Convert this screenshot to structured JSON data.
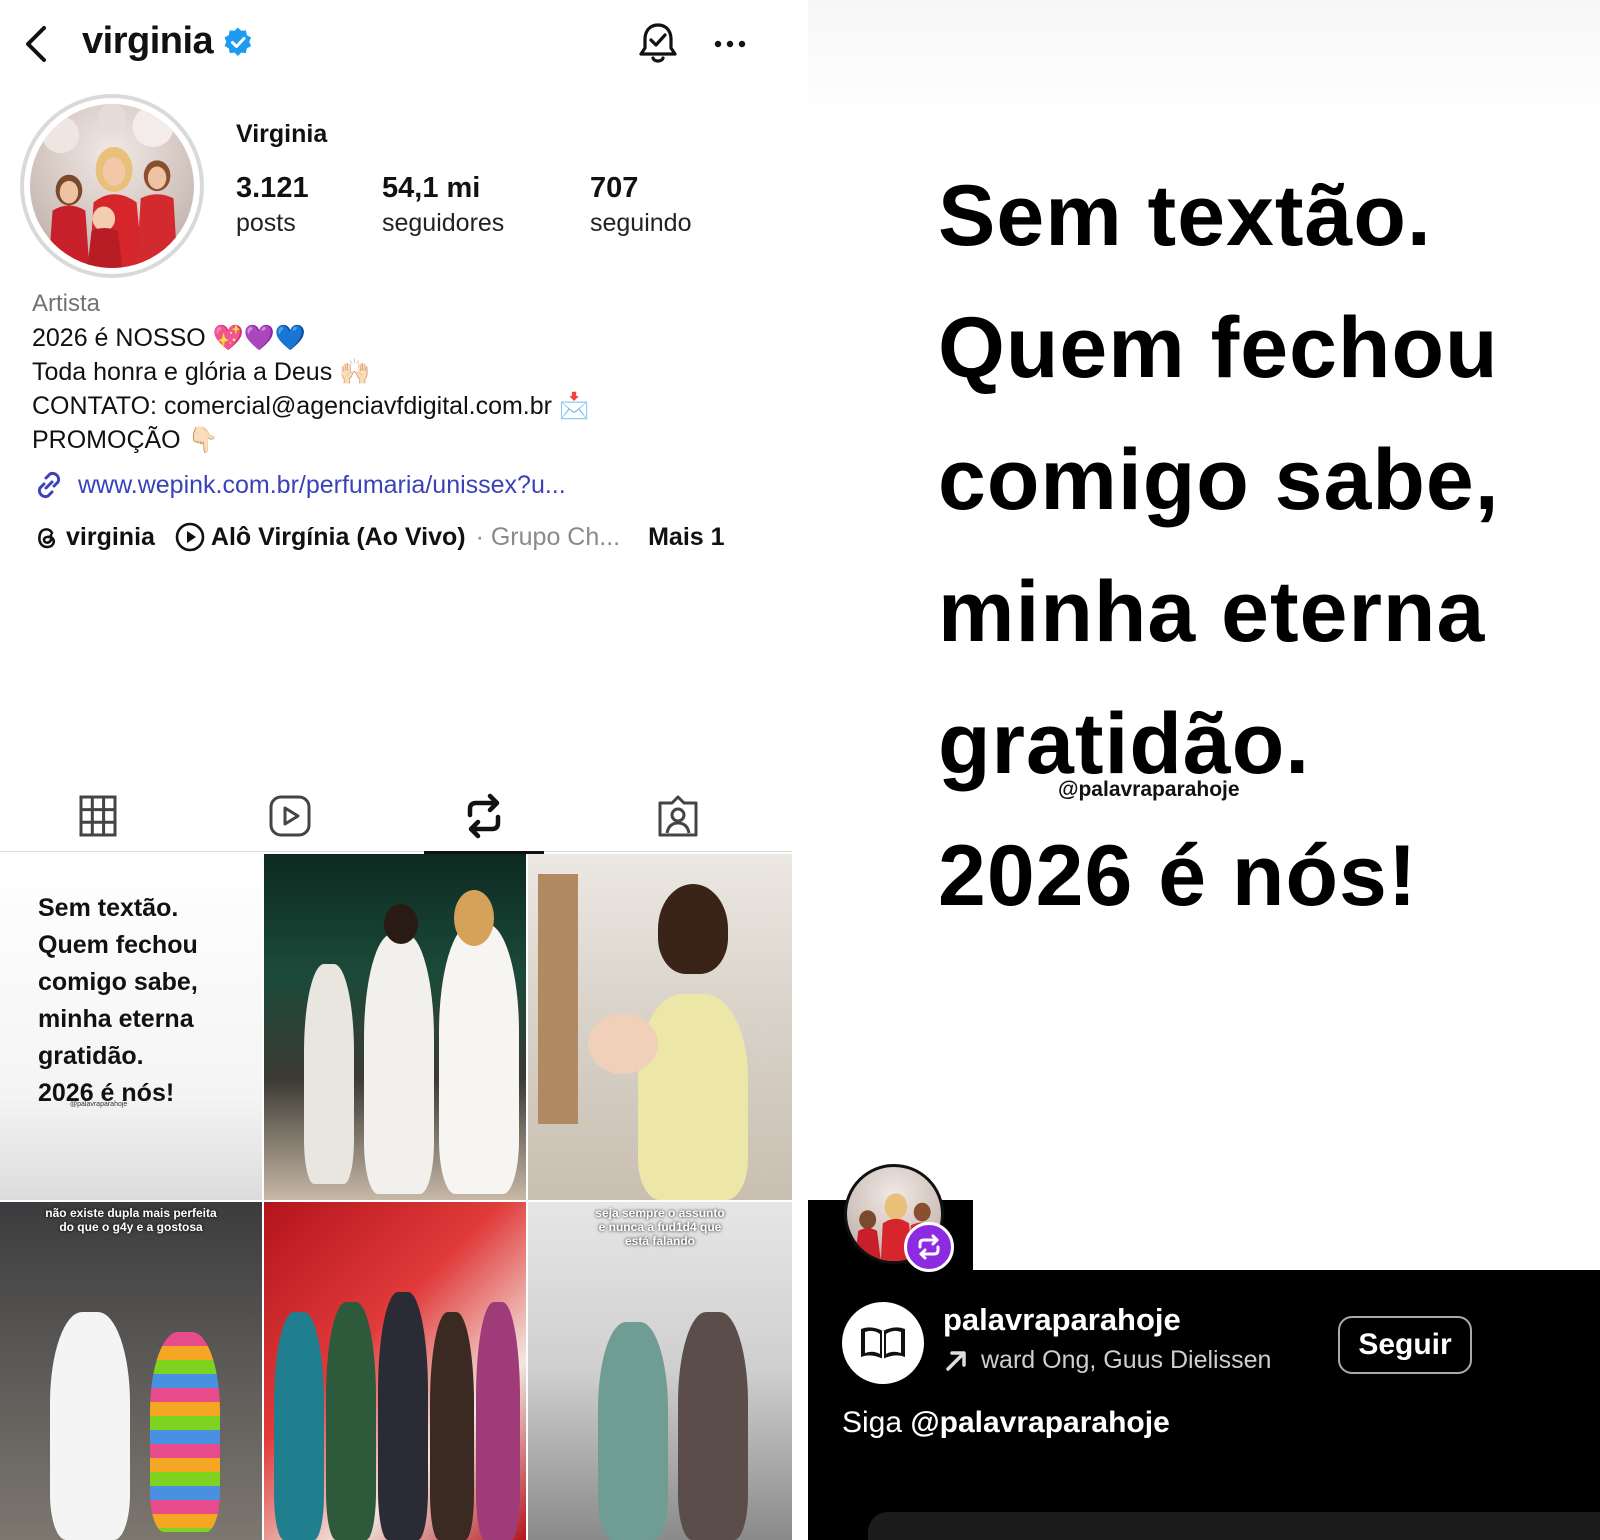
{
  "profile": {
    "handle": "virginia",
    "full_name": "Virginia",
    "stats": [
      {
        "value": "3.121",
        "label": "posts"
      },
      {
        "value": "54,1 mi",
        "label": "seguidores"
      },
      {
        "value": "707",
        "label": "seguindo"
      }
    ],
    "category": "Artista",
    "bio_lines": [
      "2026 é NOSSO 💖💜💙",
      "Toda honra e glória a Deus 🙌🏻",
      "CONTATO: comercial@agenciavfdigital.com.br 📩",
      "PROMOÇÃO 👇🏻"
    ],
    "link": "www.wepink.com.br/perfumaria/unissex?u...",
    "threads_label": "virginia",
    "live_label": "Alô Virgínia (Ao Vivo)",
    "live_sub": "· Grupo Ch...",
    "more_label": "Mais 1"
  },
  "tabs": [
    {
      "icon": "grid-icon"
    },
    {
      "icon": "reels-icon"
    },
    {
      "icon": "repost-icon",
      "active": true
    },
    {
      "icon": "tagged-icon"
    }
  ],
  "grid": {
    "text_post_lines": [
      "Sem textão.",
      "Quem fechou",
      "comigo sabe,",
      "minha eterna",
      "gratidão.",
      "2026 é nós!"
    ],
    "text_post_watermark": "@palavraparahoje",
    "caption_4": [
      "não existe dupla mais perfeita",
      "do que o g4y e a gostosa"
    ],
    "caption_6": [
      "seja sempre o assunto",
      "e nunca a fud1d4 que",
      "está falando"
    ]
  },
  "story": {
    "lines": [
      "Sem textão.",
      "Quem fechou",
      "comigo sabe,",
      "minha eterna",
      "gratidão.",
      "2026 é nós!"
    ],
    "watermark": "@palavraparahoje",
    "account": "palavraparahoje",
    "music": "ward Ong, Guus Dielissen",
    "follow_label": "Seguir",
    "caption_prefix": "Siga ",
    "caption_handle": "@palavraparahoje"
  },
  "colors": {
    "link": "#3943b7",
    "verified": "#1d9bf0",
    "repost_badge": "#8d2be2"
  }
}
